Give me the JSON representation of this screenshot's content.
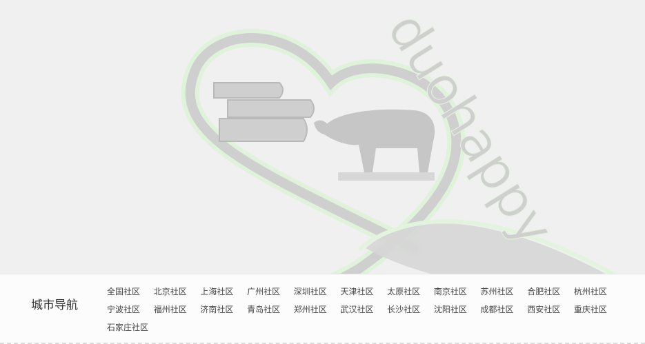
{
  "watermark": {
    "text": "duohappy",
    "color": "#c8c8c8",
    "outline_color": "#d9f0d5"
  },
  "city_nav": {
    "title": "城市导航",
    "links": [
      "全国社区",
      "北京社区",
      "上海社区",
      "广州社区",
      "深圳社区",
      "天津社区",
      "太原社区",
      "南京社区",
      "苏州社区",
      "合肥社区",
      "杭州社区",
      "宁波社区",
      "福州社区",
      "济南社区",
      "青岛社区",
      "郑州社区",
      "武汉社区",
      "长沙社区",
      "沈阳社区",
      "成都社区",
      "西安社区",
      "重庆社区",
      "石家庄社区"
    ]
  }
}
